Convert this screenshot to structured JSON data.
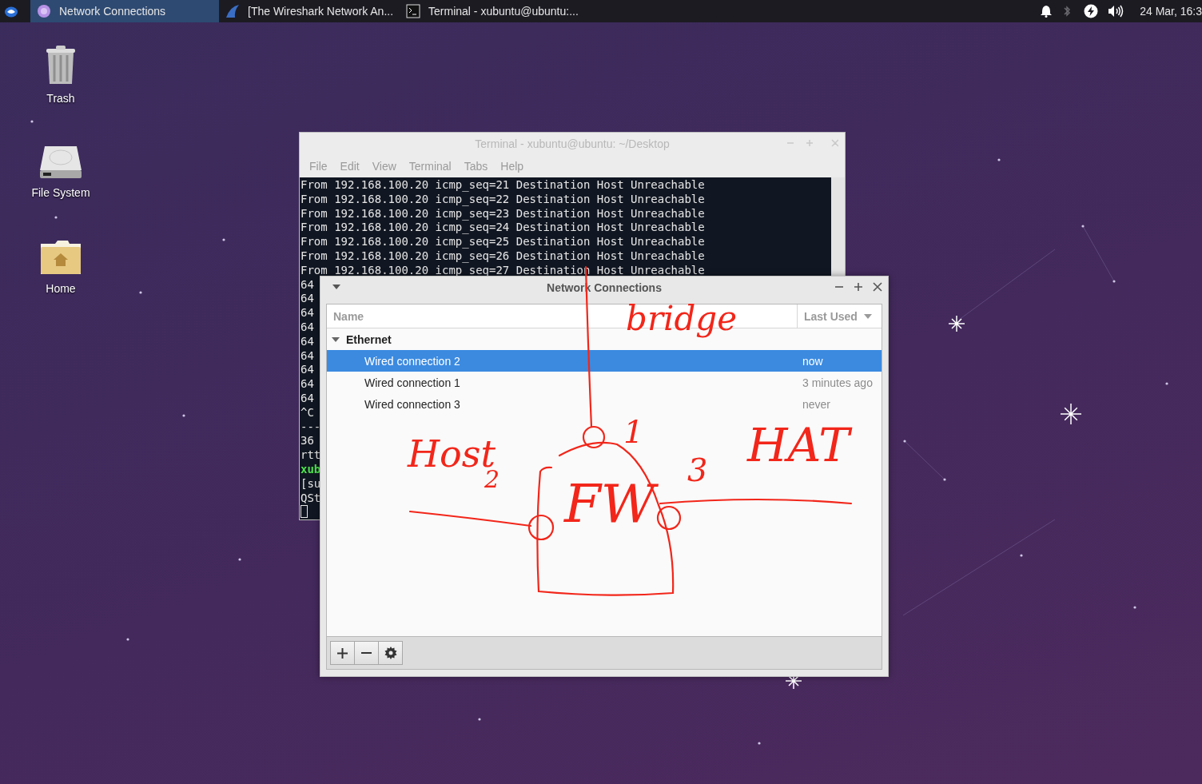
{
  "taskbar": {
    "tasks": [
      {
        "label": "Network Connections",
        "selected": true
      },
      {
        "label": "[The Wireshark Network An...",
        "selected": false
      },
      {
        "label": "Terminal - xubuntu@ubuntu:...",
        "selected": false
      }
    ],
    "clock": "24 Mar, 16:3"
  },
  "desktop_icons": [
    {
      "label": "Trash",
      "kind": "trash"
    },
    {
      "label": "File System",
      "kind": "drive"
    },
    {
      "label": "Home",
      "kind": "home"
    }
  ],
  "terminal": {
    "title": "Terminal - xubuntu@ubuntu: ~/Desktop",
    "menu": [
      "File",
      "Edit",
      "View",
      "Terminal",
      "Tabs",
      "Help"
    ],
    "lines": [
      {
        "text": "From 192.168.100.20 icmp_seq=21 Destination Host Unreachable",
        "kind": "output"
      },
      {
        "text": "From 192.168.100.20 icmp_seq=22 Destination Host Unreachable",
        "kind": "output"
      },
      {
        "text": "From 192.168.100.20 icmp_seq=23 Destination Host Unreachable",
        "kind": "output"
      },
      {
        "text": "From 192.168.100.20 icmp_seq=24 Destination Host Unreachable",
        "kind": "output"
      },
      {
        "text": "From 192.168.100.20 icmp_seq=25 Destination Host Unreachable",
        "kind": "output"
      },
      {
        "text": "From 192.168.100.20 icmp_seq=26 Destination Host Unreachable",
        "kind": "output"
      },
      {
        "text": "From 192.168.100.20 icmp_seq=27 Destination Host Unreachable",
        "kind": "output"
      },
      {
        "text": "64",
        "kind": "output"
      },
      {
        "text": "64",
        "kind": "output"
      },
      {
        "text": "64",
        "kind": "output"
      },
      {
        "text": "64",
        "kind": "output"
      },
      {
        "text": "64",
        "kind": "output"
      },
      {
        "text": "64",
        "kind": "output"
      },
      {
        "text": "64",
        "kind": "output"
      },
      {
        "text": "64",
        "kind": "output"
      },
      {
        "text": "64",
        "kind": "output"
      },
      {
        "text": "^C",
        "kind": "output"
      },
      {
        "text": "---",
        "kind": "output"
      },
      {
        "text": "36",
        "kind": "output"
      },
      {
        "text": "rtt",
        "kind": "output"
      },
      {
        "text": "xub",
        "kind": "prompt"
      },
      {
        "text": "[su",
        "kind": "output"
      },
      {
        "text": "QSt",
        "kind": "output"
      },
      {
        "kind": "cursor"
      }
    ]
  },
  "network_connections": {
    "title": "Network Connections",
    "columns": [
      "Name",
      "Last Used"
    ],
    "groups": [
      {
        "label": "Ethernet",
        "expanded": true,
        "children": [
          {
            "name": "Wired connection 2",
            "last_used": "now",
            "selected": true
          },
          {
            "name": "Wired connection 1",
            "last_used": "3 minutes ago",
            "selected": false
          },
          {
            "name": "Wired connection 3",
            "last_used": "never",
            "selected": false
          }
        ]
      }
    ],
    "toolbar": [
      {
        "kind": "add"
      },
      {
        "kind": "remove"
      },
      {
        "kind": "settings"
      }
    ]
  },
  "annotation": {
    "labels": [
      "bridge",
      "Host",
      "2",
      "FW",
      "1",
      "3",
      "HAT"
    ]
  }
}
